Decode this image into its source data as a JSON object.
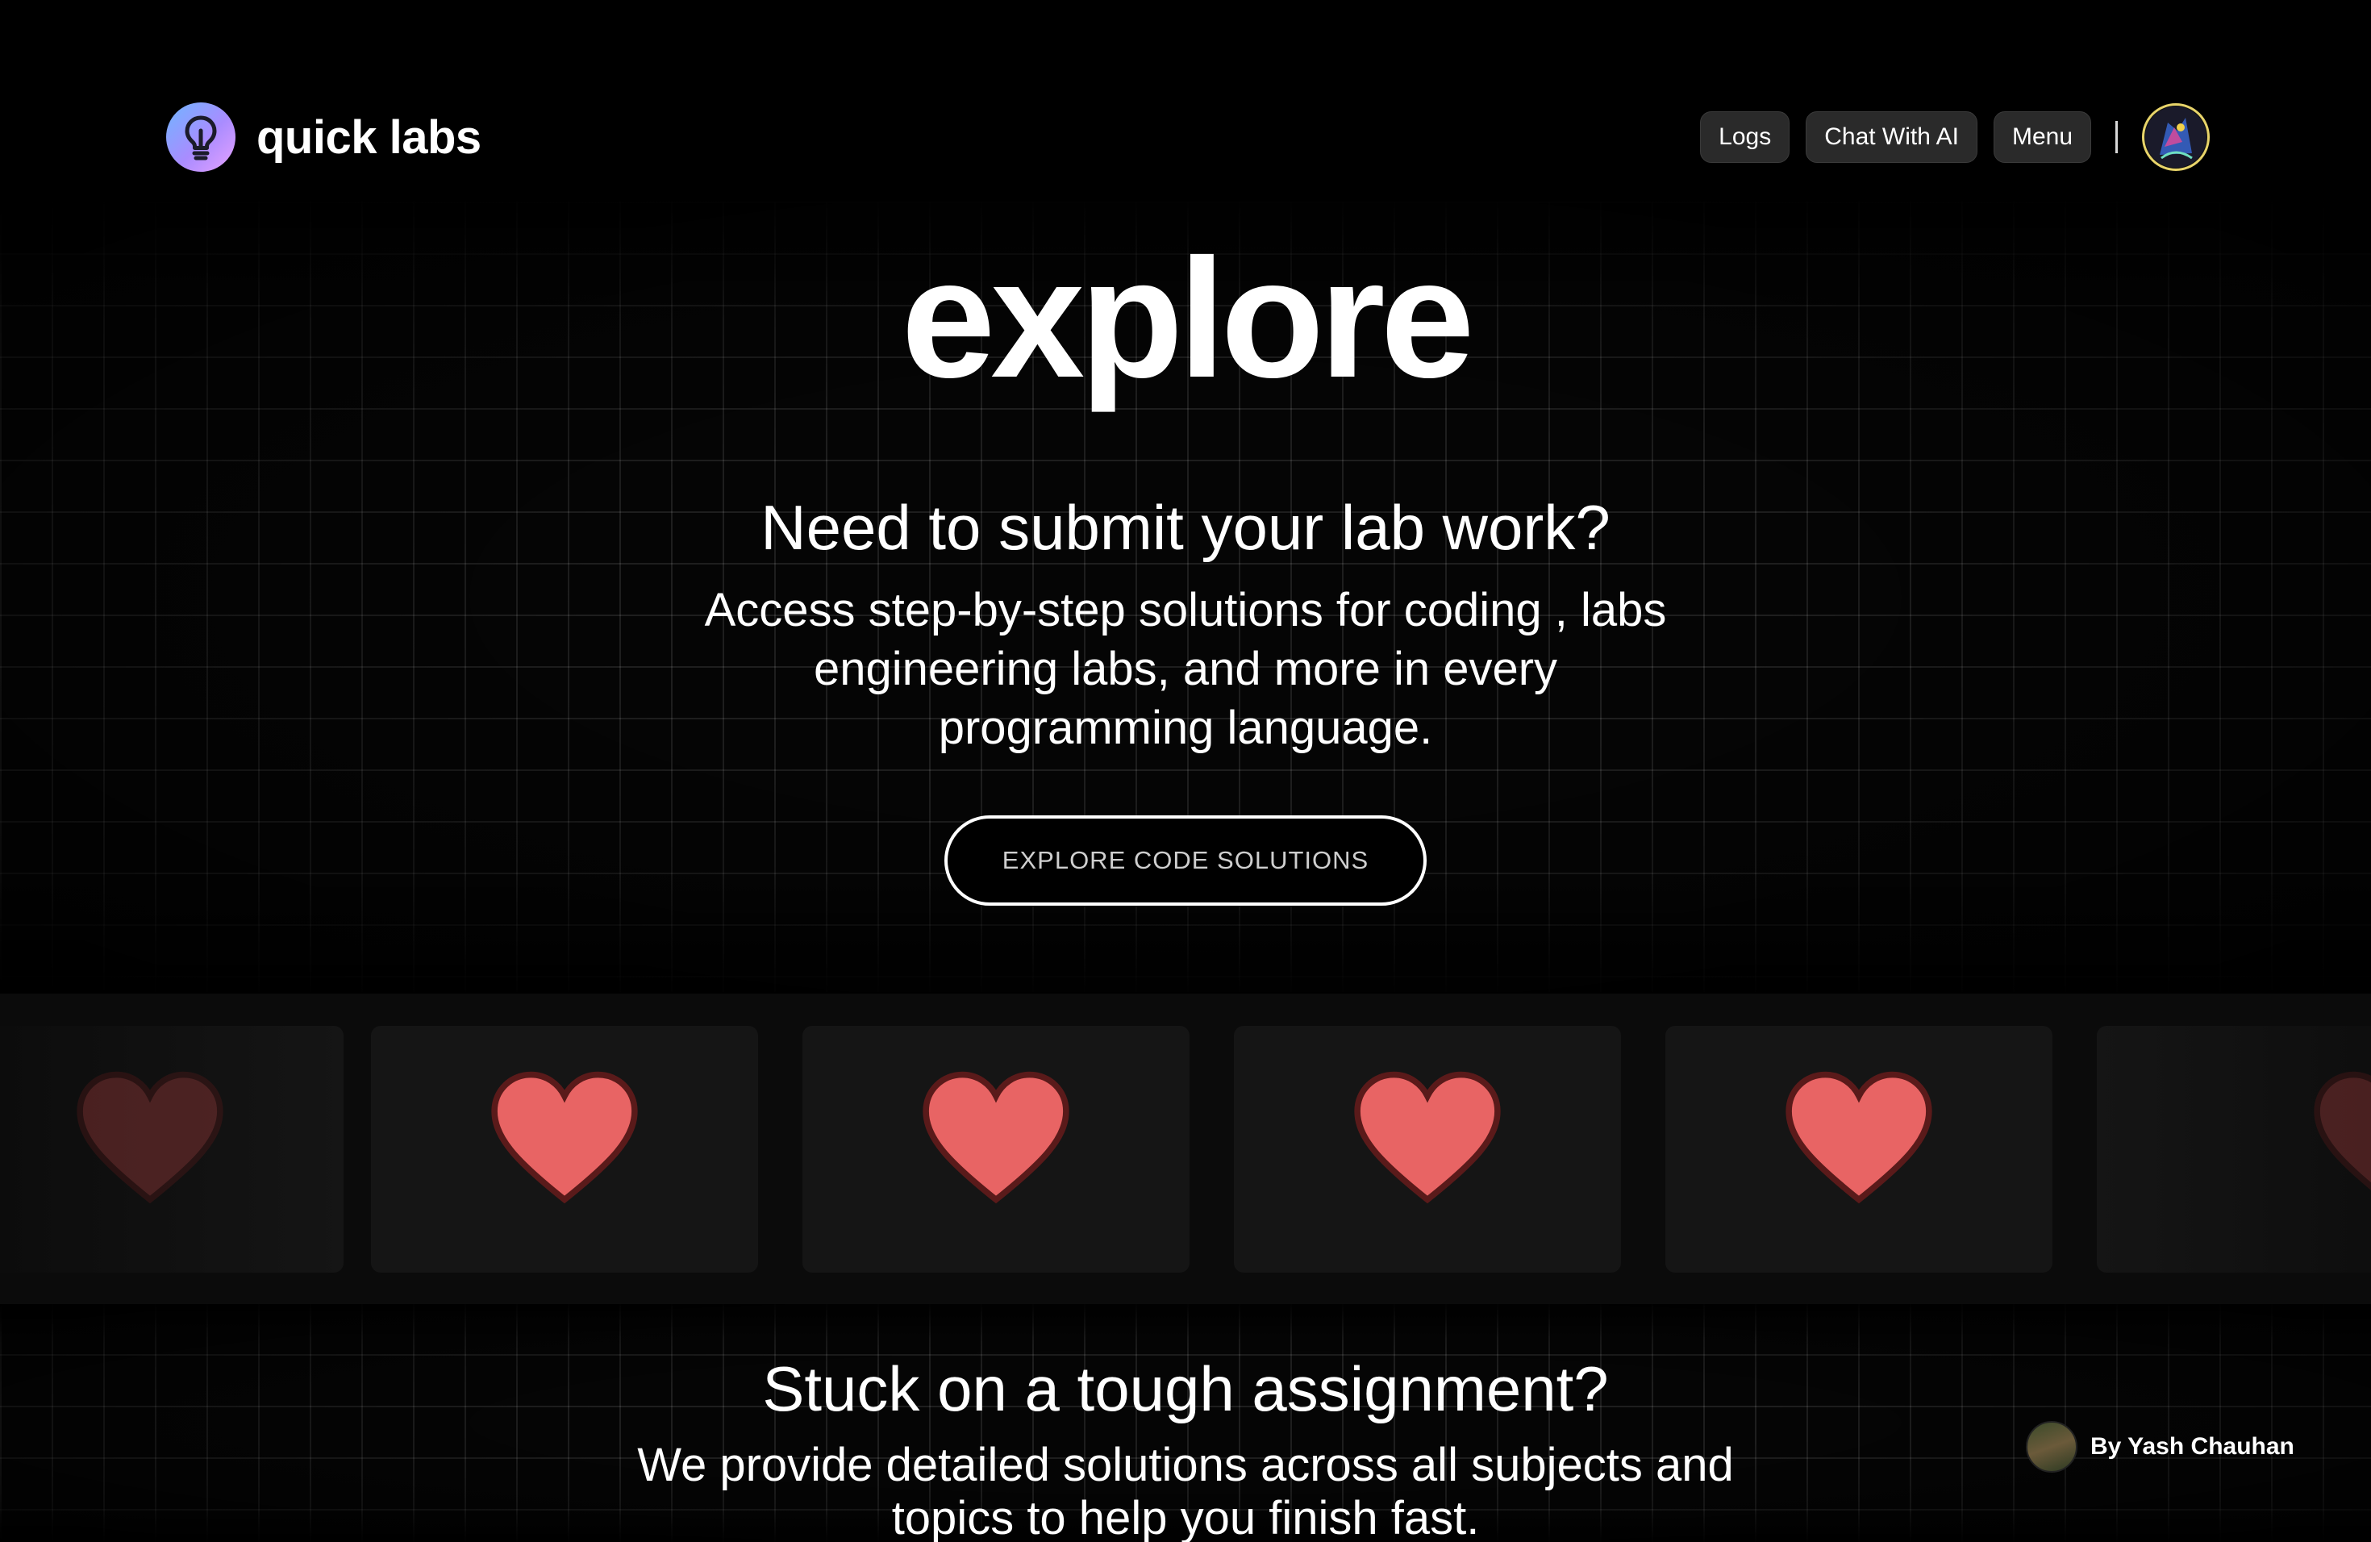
{
  "header": {
    "brand_name": "quick labs",
    "nav": {
      "logs_label": "Logs",
      "chat_label": "Chat With AI",
      "menu_label": "Menu",
      "separator": "|"
    }
  },
  "hero": {
    "title": "explore",
    "heading": "Need to submit your lab work?",
    "description": "Access step-by-step solutions for coding , labs engineering labs, and more in every programming language.",
    "cta_label": "EXPLORE CODE SOLUTIONS"
  },
  "cards": [
    {
      "icon": "heart-icon",
      "state": "faded"
    },
    {
      "icon": "heart-icon",
      "state": "full"
    },
    {
      "icon": "heart-icon",
      "state": "full"
    },
    {
      "icon": "heart-icon",
      "state": "full"
    },
    {
      "icon": "heart-icon",
      "state": "full"
    },
    {
      "icon": "heart-icon",
      "state": "faded"
    }
  ],
  "section2": {
    "heading": "Stuck on a tough assignment?",
    "description": "We provide detailed solutions across all subjects and topics to help you finish fast."
  },
  "author": {
    "label": "By Yash Chauhan"
  },
  "colors": {
    "background": "#000000",
    "heart": "#e86464",
    "brand_gradient_start": "#6fb6ff",
    "brand_gradient_end": "#e7a2ff",
    "avatar_ring": "#e8d46a"
  }
}
